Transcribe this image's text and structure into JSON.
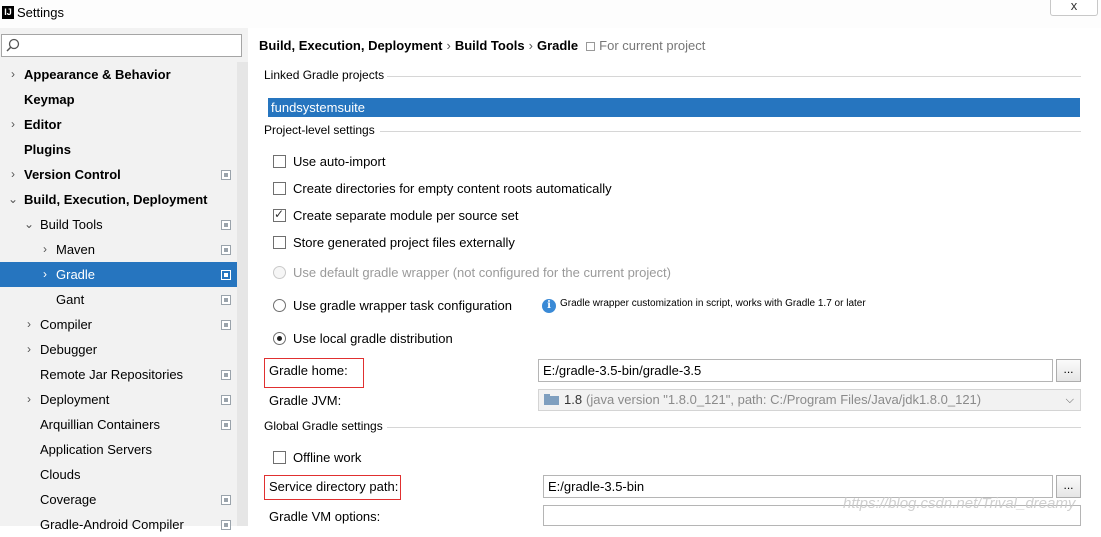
{
  "window": {
    "title": "Settings",
    "close_label": "x"
  },
  "search": {
    "placeholder": ""
  },
  "sidebar": {
    "items": [
      {
        "label": "Appearance & Behavior",
        "bold": true,
        "arrow": "›",
        "indent": 0,
        "proj": false
      },
      {
        "label": "Keymap",
        "bold": true,
        "arrow": "",
        "indent": 0,
        "proj": false
      },
      {
        "label": "Editor",
        "bold": true,
        "arrow": "›",
        "indent": 0,
        "proj": false
      },
      {
        "label": "Plugins",
        "bold": true,
        "arrow": "",
        "indent": 0,
        "proj": false
      },
      {
        "label": "Version Control",
        "bold": true,
        "arrow": "›",
        "indent": 0,
        "proj": true
      },
      {
        "label": "Build, Execution, Deployment",
        "bold": true,
        "arrow": "⌄",
        "indent": 0,
        "proj": false
      },
      {
        "label": "Build Tools",
        "bold": false,
        "arrow": "⌄",
        "indent": 1,
        "proj": true
      },
      {
        "label": "Maven",
        "bold": false,
        "arrow": "›",
        "indent": 2,
        "proj": true
      },
      {
        "label": "Gradle",
        "bold": false,
        "arrow": "›",
        "indent": 2,
        "proj": true,
        "selected": true
      },
      {
        "label": "Gant",
        "bold": false,
        "arrow": "",
        "indent": 2,
        "proj": true
      },
      {
        "label": "Compiler",
        "bold": false,
        "arrow": "›",
        "indent": 1,
        "proj": true
      },
      {
        "label": "Debugger",
        "bold": false,
        "arrow": "›",
        "indent": 1,
        "proj": false
      },
      {
        "label": "Remote Jar Repositories",
        "bold": false,
        "arrow": "",
        "indent": 1,
        "proj": true
      },
      {
        "label": "Deployment",
        "bold": false,
        "arrow": "›",
        "indent": 1,
        "proj": true
      },
      {
        "label": "Arquillian Containers",
        "bold": false,
        "arrow": "",
        "indent": 1,
        "proj": true
      },
      {
        "label": "Application Servers",
        "bold": false,
        "arrow": "",
        "indent": 1,
        "proj": false
      },
      {
        "label": "Clouds",
        "bold": false,
        "arrow": "",
        "indent": 1,
        "proj": false
      },
      {
        "label": "Coverage",
        "bold": false,
        "arrow": "",
        "indent": 1,
        "proj": true
      },
      {
        "label": "Gradle-Android Compiler",
        "bold": false,
        "arrow": "",
        "indent": 1,
        "proj": true
      }
    ]
  },
  "breadcrumb": {
    "parts": [
      "Build, Execution, Deployment",
      "Build Tools",
      "Gradle"
    ],
    "separator": "›",
    "scope": "For current project"
  },
  "sections": {
    "linked": "Linked Gradle projects",
    "project_level": "Project-level settings",
    "global": "Global Gradle settings"
  },
  "linked_project": "fundsystemsuite",
  "options": {
    "auto_import": "Use auto-import",
    "create_dirs": "Create directories for empty content roots automatically",
    "separate_module": "Create separate module per source set",
    "store_external": "Store generated project files externally",
    "default_wrapper": "Use default gradle wrapper (not configured for the current project)",
    "wrapper_task": "Use gradle wrapper task configuration",
    "local_dist": "Use local gradle distribution",
    "offline": "Offline work"
  },
  "info_text": "Gradle wrapper customization in script, works with Gradle 1.7 or later",
  "gradle_home": {
    "label": "Gradle home:",
    "value": "E:/gradle-3.5-bin/gradle-3.5",
    "browse": "..."
  },
  "gradle_jvm": {
    "label": "Gradle JVM:",
    "version": "1.8",
    "detail": "(java version \"1.8.0_121\", path: C:/Program Files/Java/jdk1.8.0_121)"
  },
  "service_dir": {
    "label": "Service directory path:",
    "value": "E:/gradle-3.5-bin",
    "browse": "..."
  },
  "vm_options": {
    "label": "Gradle VM options:",
    "value": ""
  },
  "watermark": "https://blog.csdn.net/Trival_dreamy"
}
